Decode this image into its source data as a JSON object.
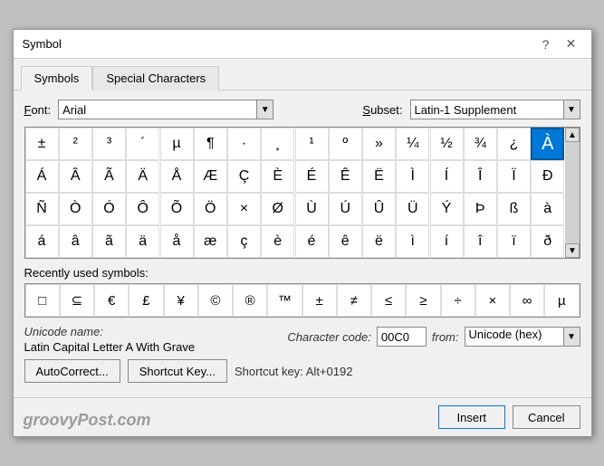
{
  "title": "Symbol",
  "tabs": [
    {
      "id": "symbols",
      "label": "Symbols",
      "active": true
    },
    {
      "id": "special",
      "label": "Special Characters",
      "active": false
    }
  ],
  "font": {
    "label": "Font:",
    "value": "Arial",
    "underline_char": "F"
  },
  "subset": {
    "label": "Subset:",
    "value": "Latin-1 Supplement",
    "underline_char": "S"
  },
  "symbol_grid": [
    [
      "±",
      "²",
      "³",
      "´",
      "µ",
      "¶",
      "·",
      "¸",
      "¹",
      "º",
      "»",
      "¼",
      "½",
      "¾",
      "¿",
      "À"
    ],
    [
      "Á",
      "Â",
      "Ã",
      "Ä",
      "Å",
      "Æ",
      "Ç",
      "È",
      "É",
      "Ê",
      "Ë",
      "Ì",
      "Í",
      "Î",
      "Ï",
      "Ð"
    ],
    [
      "Ñ",
      "Ò",
      "Ó",
      "Ô",
      "Õ",
      "Ö",
      "×",
      "Ø",
      "Ù",
      "Ú",
      "Û",
      "Ü",
      "Ý",
      "Þ",
      "ß",
      "à"
    ],
    [
      "á",
      "â",
      "ã",
      "ä",
      "å",
      "æ",
      "ç",
      "è",
      "é",
      "ê",
      "ë",
      "ì",
      "í",
      "î",
      "ï",
      "ð"
    ]
  ],
  "selected_symbol": "À",
  "selected_row": 0,
  "selected_col": 15,
  "recently_used": {
    "label": "Recently used symbols:",
    "symbols": [
      "□",
      "⊆",
      "€",
      "£",
      "¥",
      "©",
      "®",
      "™",
      "±",
      "≠",
      "≤",
      "≥",
      "÷",
      "×",
      "∞",
      "µ"
    ]
  },
  "unicode": {
    "name_label": "Unicode name:",
    "name_value": "Latin Capital Letter A With Grave"
  },
  "charcode": {
    "label": "Character code:",
    "value": "00C0",
    "from_label": "from:",
    "from_value": "Unicode (hex)"
  },
  "buttons": {
    "autocorrect": "AutoCorrect...",
    "shortcut_key": "Shortcut Key...",
    "shortcut_info": "Shortcut key: Alt+0192"
  },
  "bottom_buttons": {
    "insert": "Insert",
    "cancel": "Cancel"
  },
  "watermark": "groovyPost.com",
  "help_icon": "?",
  "close_icon": "✕"
}
